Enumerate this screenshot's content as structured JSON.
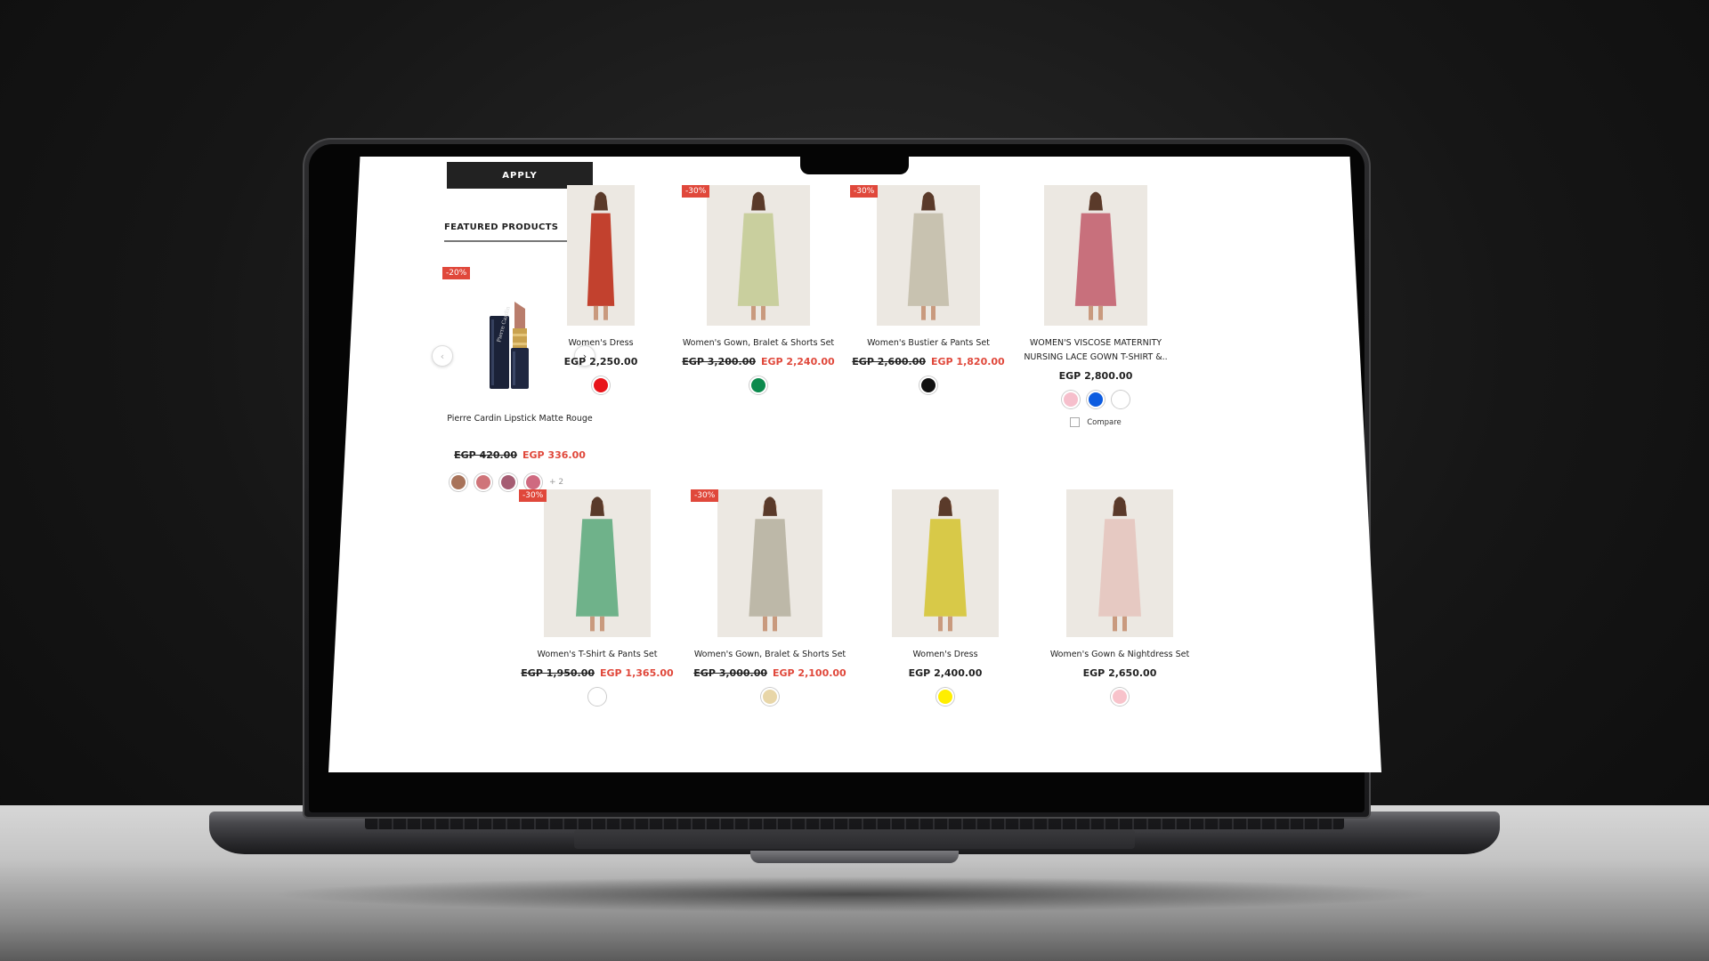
{
  "sidebar": {
    "apply_label": "APPLY",
    "featured_title": "FEATURED PRODUCTS",
    "featured_product": {
      "badge": "-20%",
      "name": "Pierre Cardin Lipstick Matte Rouge",
      "price_old": "EGP 420.00",
      "price_new": "EGP 336.00",
      "swatches": [
        "#a8735a",
        "#cf7479",
        "#a55c72",
        "#cf6a80"
      ],
      "more": "+ 2",
      "brand_logo_text": "Pierre Cardin"
    }
  },
  "products": [
    {
      "name": "Women's Dress",
      "badge": "",
      "price_old": "",
      "price_new": "",
      "price": "EGP 2,250.00",
      "swatches": [
        "#e8141a"
      ],
      "compare": "",
      "garment_color": "#c2412e"
    },
    {
      "name": "Women's Gown, Bralet & Shorts Set",
      "badge": "-30%",
      "price_old": "EGP 3,200.00",
      "price_new": "EGP 2,240.00",
      "price": "",
      "swatches": [
        "#0c8a4d"
      ],
      "compare": "",
      "garment_color": "#c9cf9e"
    },
    {
      "name": "Women's Bustier & Pants Set",
      "badge": "-30%",
      "price_old": "EGP 2,600.00",
      "price_new": "EGP 1,820.00",
      "price": "",
      "swatches": [
        "#111111"
      ],
      "compare": "",
      "garment_color": "#c8c2b0"
    },
    {
      "name": "WOMEN'S VISCOSE MATERNITY NURSING LACE GOWN T-SHIRT &..",
      "badge": "",
      "price_old": "",
      "price_new": "",
      "price": "EGP 2,800.00",
      "swatches": [
        "#f6bfcc",
        "#0d5ce0",
        "#ffffff"
      ],
      "compare": "Compare",
      "garment_color": "#c8707c"
    },
    {
      "name": "Women's T-Shirt & Pants Set",
      "badge": "-30%",
      "price_old": "EGP 1,950.00",
      "price_new": "EGP 1,365.00",
      "price": "",
      "swatches": [
        "#ffffff"
      ],
      "compare": "",
      "garment_color": "#6fb28a"
    },
    {
      "name": "Women's Gown, Bralet & Shorts Set",
      "badge": "-30%",
      "price_old": "EGP 3,000.00",
      "price_new": "EGP 2,100.00",
      "price": "",
      "swatches": [
        "#e8d6a8"
      ],
      "compare": "",
      "garment_color": "#bdb8a8"
    },
    {
      "name": "Women's Dress",
      "badge": "",
      "price_old": "",
      "price_new": "",
      "price": "EGP 2,400.00",
      "swatches": [
        "#ffee00"
      ],
      "compare": "",
      "garment_color": "#d8c948"
    },
    {
      "name": "Women's Gown & Nightdress Set",
      "badge": "",
      "price_old": "",
      "price_new": "",
      "price": "EGP 2,650.00",
      "swatches": [
        "#f8c3cb"
      ],
      "compare": "",
      "garment_color": "#e6c9c2"
    }
  ],
  "colors": {
    "sale": "#e0483b",
    "button_dark": "#222222"
  }
}
